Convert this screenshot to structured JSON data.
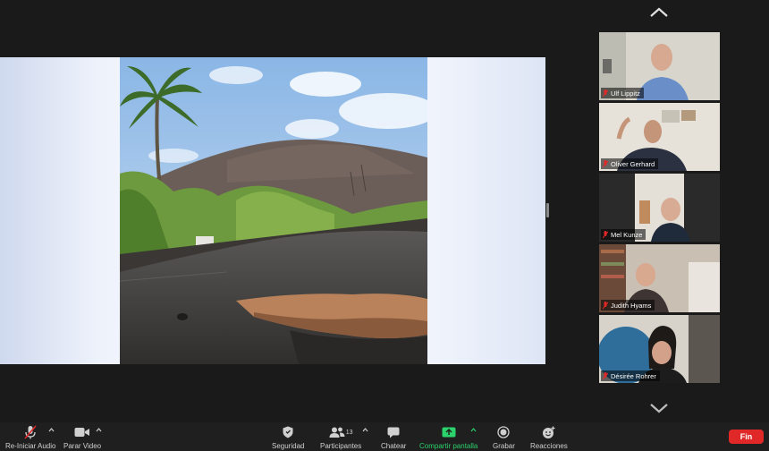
{
  "participants": [
    {
      "name": "Ulf Lippitz",
      "muted": true
    },
    {
      "name": "Oliver Gerhard",
      "muted": true
    },
    {
      "name": "Mel Kunze",
      "muted": true
    },
    {
      "name": "Judith Hyams",
      "muted": true
    },
    {
      "name": "Désirée Rohrer",
      "muted": true
    }
  ],
  "toolbar": {
    "audio_label": "Re-Iniciar Audio",
    "video_label": "Parar Video",
    "security_label": "Seguridad",
    "participants_label": "Participantes",
    "participants_count": "13",
    "chat_label": "Chatear",
    "share_label": "Compartir pantalla",
    "record_label": "Grabar",
    "reactions_label": "Reacciones",
    "end_label": "Fin"
  },
  "colors": {
    "accent_green": "#2bd16b",
    "end_red": "#e02828",
    "muted_red": "#e02828",
    "background": "#1a1a1a"
  },
  "icons": {
    "audio": "mic-muted-icon",
    "video": "video-camera-icon",
    "security": "shield-icon",
    "participants": "people-icon",
    "chat": "chat-bubble-icon",
    "share": "share-screen-icon",
    "record": "record-icon",
    "reactions": "emoji-plus-icon",
    "gallery_prev": "chevron-up-icon",
    "gallery_next": "chevron-down-icon"
  }
}
